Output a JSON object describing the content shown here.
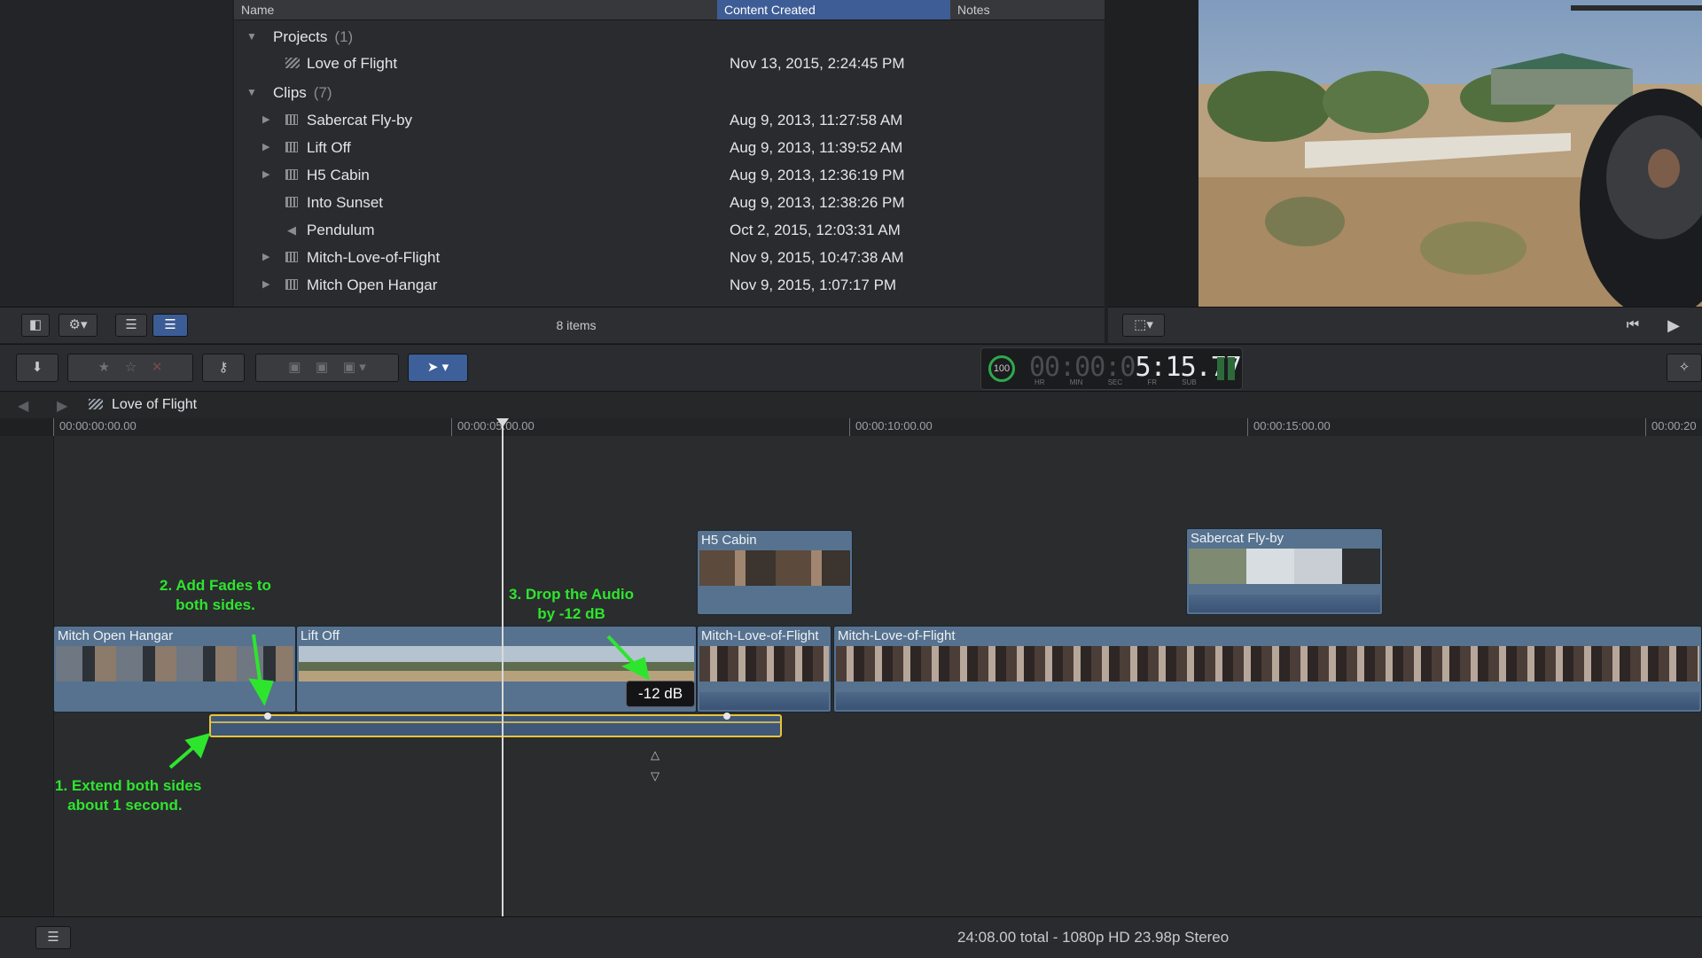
{
  "browser": {
    "columns": {
      "name": "Name",
      "content_created": "Content Created",
      "notes": "Notes"
    },
    "groups": [
      {
        "label": "Projects",
        "count": "(1)",
        "items": [
          {
            "name": "Love of Flight",
            "date": "Nov 13, 2015, 2:24:45 PM"
          }
        ]
      },
      {
        "label": "Clips",
        "count": "(7)",
        "items": [
          {
            "name": "Sabercat Fly-by",
            "date": "Aug 9, 2013, 11:27:58 AM"
          },
          {
            "name": "Lift Off",
            "date": "Aug 9, 2013, 11:39:52 AM"
          },
          {
            "name": "H5 Cabin",
            "date": "Aug 9, 2013, 12:36:19 PM"
          },
          {
            "name": "Into Sunset",
            "date": "Aug 9, 2013, 12:38:26 PM"
          },
          {
            "name": "Pendulum",
            "date": "Oct 2, 2015, 12:03:31 AM"
          },
          {
            "name": "Mitch-Love-of-Flight",
            "date": "Nov 9, 2015, 10:47:38 AM"
          },
          {
            "name": "Mitch Open Hangar",
            "date": "Nov 9, 2015, 1:07:17 PM"
          }
        ]
      }
    ],
    "item_count": "8 items"
  },
  "timecode": {
    "percent": "100",
    "display": "00:00:05:15.77",
    "dim_part": "00:00:0",
    "bright_part": "5:15.77",
    "labels": [
      "HR",
      "MIN",
      "SEC",
      "FR",
      "SUB"
    ]
  },
  "timeline": {
    "project_title": "Love of Flight",
    "ruler": [
      "00:00:00:00.00",
      "00:00:05:00.00",
      "00:00:10:00.00",
      "00:00:15:00.00",
      "00:00:20"
    ],
    "clips": {
      "h5_cabin": "H5 Cabin",
      "sabercat": "Sabercat Fly-by",
      "mitch_open_hangar": "Mitch Open Hangar",
      "lift_off": "Lift Off",
      "mitch_love_1": "Mitch-Love-of-Flight",
      "mitch_love_2": "Mitch-Love-of-Flight"
    },
    "volume_badge": "-12 dB"
  },
  "annotations": {
    "step1": "1. Extend both sides\n   about 1 second.",
    "step2": "2. Add Fades to\nboth sides.",
    "step3": "3. Drop the Audio\nby -12 dB"
  },
  "status": "24:08.00 total - 1080p HD 23.98p Stereo",
  "colors": {
    "accent": "#3e5d97",
    "annotation": "#2ee52e",
    "playhead": "#d9d9d9",
    "selection": "#e8c43a"
  }
}
